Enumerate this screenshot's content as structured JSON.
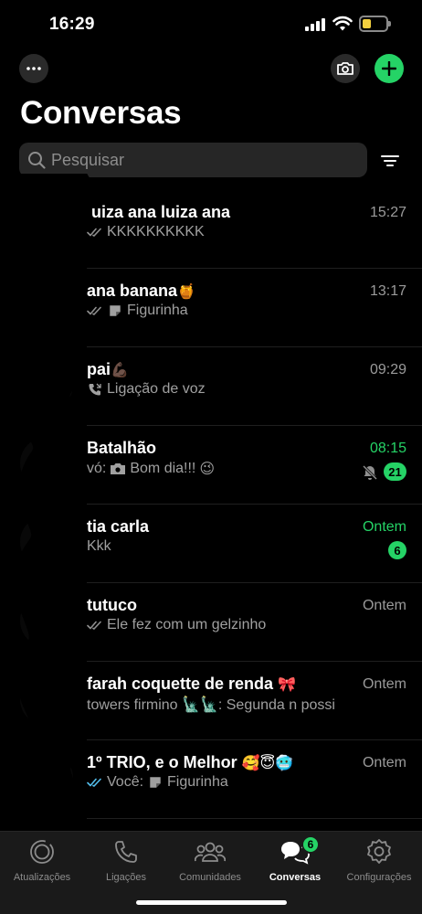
{
  "status_bar": {
    "time": "16:29",
    "icons": [
      "cellular-signal-icon",
      "wifi-icon",
      "battery-icon"
    ],
    "battery_color": "#f4d03f"
  },
  "header": {
    "title": "Conversas",
    "icons": [
      "more-icon",
      "camera-icon",
      "plus-icon"
    ],
    "accent": "#25d366"
  },
  "search": {
    "placeholder": "Pesquisar"
  },
  "chats": [
    {
      "name": "luiza ana luiza ana",
      "name_emoji": "",
      "time": "15:27",
      "time_unread": false,
      "preview_prefix": "",
      "preview_icon": "double-check-icon",
      "preview_icon2": "",
      "preview": "KKKKKKKKKK",
      "preview_emoji": "",
      "badge": "",
      "muted": false
    },
    {
      "name": "ana banana",
      "name_emoji": "🍯",
      "time": "13:17",
      "time_unread": false,
      "preview_prefix": "",
      "preview_icon": "double-check-icon",
      "preview_icon2": "sticker-icon",
      "preview": "Figurinha",
      "preview_emoji": "",
      "badge": "",
      "muted": false
    },
    {
      "name": "pai",
      "name_emoji": "💪🏿",
      "time": "09:29",
      "time_unread": false,
      "preview_prefix": "",
      "preview_icon": "phone-call-icon",
      "preview_icon2": "",
      "preview": "Ligação de voz",
      "preview_emoji": "",
      "badge": "",
      "muted": false
    },
    {
      "name": "Batalhão",
      "name_emoji": "",
      "time": "08:15",
      "time_unread": true,
      "preview_prefix": "vó:",
      "preview_icon": "camera-icon",
      "preview_icon2": "",
      "preview": "Bom dia!!!",
      "preview_emoji": "😉",
      "badge": "21",
      "muted": true
    },
    {
      "name": "tia carla",
      "name_emoji": "",
      "time": "Ontem",
      "time_unread": true,
      "preview_prefix": "",
      "preview_icon": "",
      "preview_icon2": "",
      "preview": "Kkk",
      "preview_emoji": "",
      "badge": "6",
      "muted": false
    },
    {
      "name": "tutuco",
      "name_emoji": "",
      "time": "Ontem",
      "time_unread": false,
      "preview_prefix": "",
      "preview_icon": "double-check-icon",
      "preview_icon2": "",
      "preview": "Ele fez com um gelzinho",
      "preview_emoji": "",
      "badge": "",
      "muted": false
    },
    {
      "name": "farah coquette de renda",
      "name_emoji": "🎀",
      "time": "Ontem",
      "time_unread": false,
      "preview_prefix": "",
      "preview_icon": "",
      "preview_icon2": "",
      "preview": "towers firmino 🗽🗽: Segunda n possi",
      "preview_emoji": "",
      "badge": "",
      "muted": false
    },
    {
      "name": "1º TRIO, e o Melhor",
      "name_emoji": "🥰😇🥶",
      "time": "Ontem",
      "time_unread": false,
      "preview_prefix": "",
      "preview_icon": "blue-double-check-icon",
      "preview_icon2": "",
      "preview": "Você:",
      "preview_emoji": "",
      "preview_icon3": "sticker-icon",
      "preview_tail": "Figurinha",
      "badge": "",
      "muted": false
    }
  ],
  "tabs": [
    {
      "label": "Atualizações",
      "icon": "status-updates-icon",
      "active": false,
      "badge": ""
    },
    {
      "label": "Ligações",
      "icon": "phone-icon",
      "active": false,
      "badge": ""
    },
    {
      "label": "Comunidades",
      "icon": "communities-icon",
      "active": false,
      "badge": ""
    },
    {
      "label": "Conversas",
      "icon": "chats-icon",
      "active": true,
      "badge": "6"
    },
    {
      "label": "Configurações",
      "icon": "settings-icon",
      "active": false,
      "badge": ""
    }
  ]
}
